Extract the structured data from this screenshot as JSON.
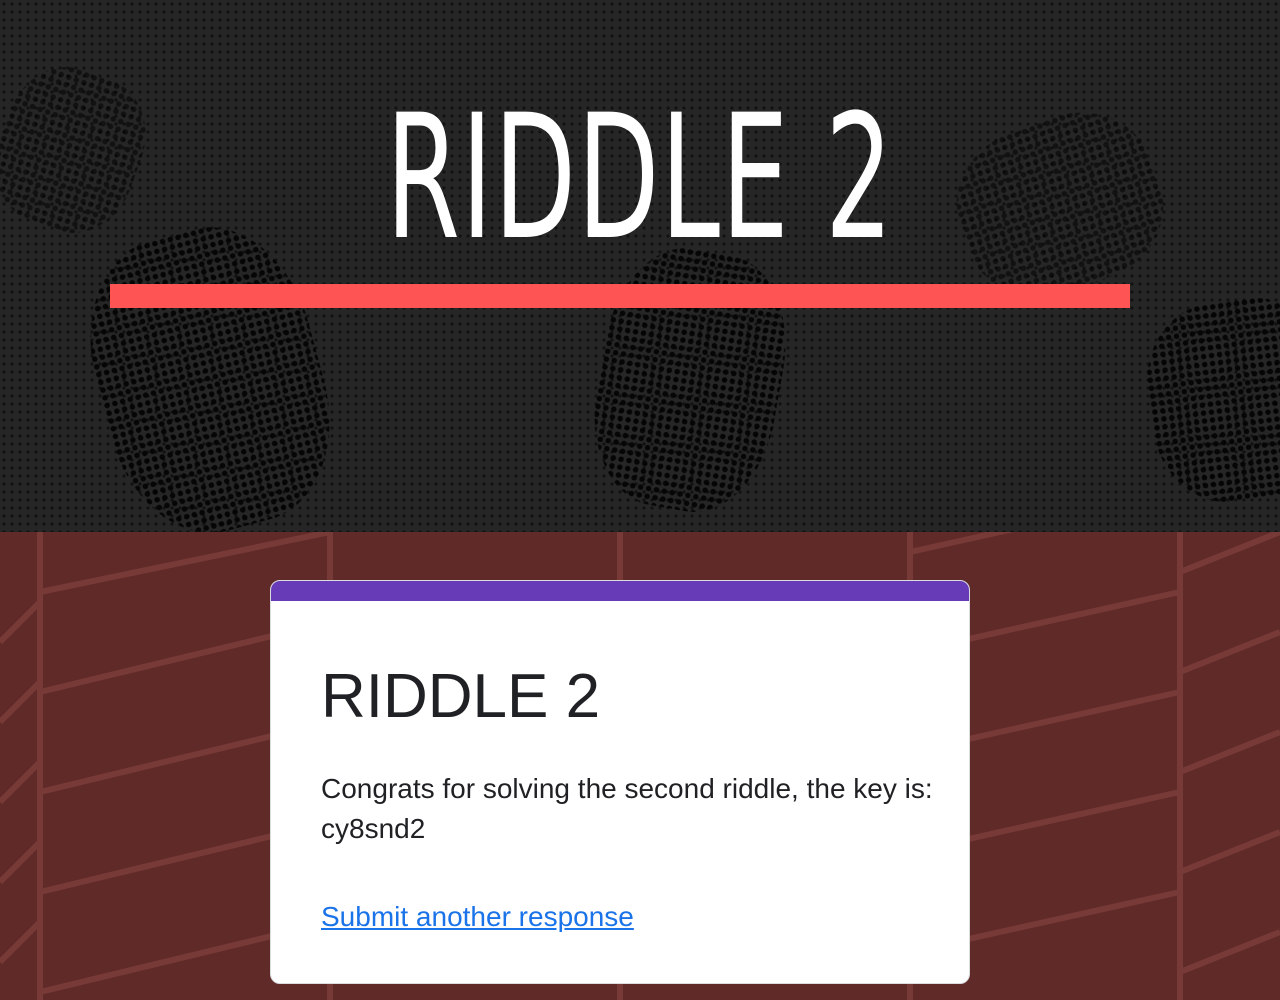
{
  "header": {
    "title": "RIDDLE 2",
    "underline_color": "#ff5454"
  },
  "form": {
    "accent_color": "#673ab7",
    "title": "RIDDLE 2",
    "message": "Congrats for solving the second riddle, the key is:    cy8snd2",
    "submit_another_label": "Submit another response"
  },
  "colors": {
    "header_background": "#262626",
    "page_background": "#5f2a27",
    "link": "#1a73e8"
  }
}
